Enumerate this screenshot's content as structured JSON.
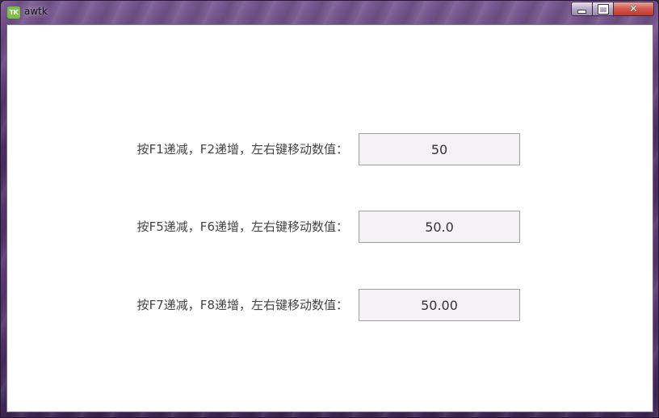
{
  "window": {
    "title": "awtk",
    "icon_text": "TK",
    "close_symbol": "✕"
  },
  "rows": [
    {
      "label": "按F1递减，F2递增，左右键移动数值：",
      "value": "50"
    },
    {
      "label": "按F5递减，F6递增，左右键移动数值：",
      "value": "50.0"
    },
    {
      "label": "按F7递减，F8递增，左右键移动数值：",
      "value": "50.00"
    }
  ],
  "colors": {
    "accent_icon": "#7cc242",
    "close_button": "#c1392c",
    "input_background": "#f4f2f4",
    "label_text": "#444444"
  },
  "icons": [
    "app-logo-icon",
    "minimize-icon",
    "maximize-icon",
    "close-icon"
  ]
}
